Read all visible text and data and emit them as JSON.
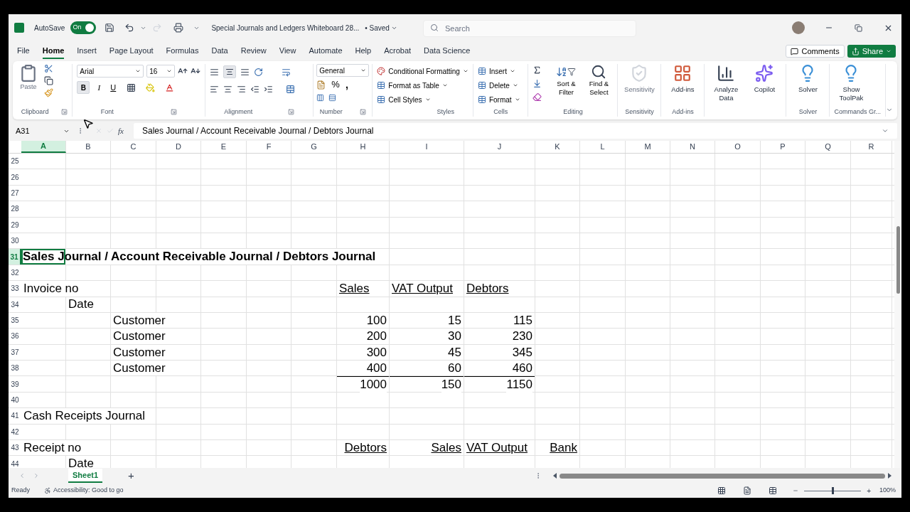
{
  "title_bar": {
    "autosave_label": "AutoSave",
    "autosave_on": true,
    "toggle_text": "On",
    "document_title": "Special Journals and Ledgers Whiteboard 28...",
    "save_status": "• Saved",
    "search_placeholder": "Search"
  },
  "menu_tabs": [
    {
      "label": "File",
      "selected": false
    },
    {
      "label": "Home",
      "selected": true
    },
    {
      "label": "Insert",
      "selected": false
    },
    {
      "label": "Page Layout",
      "selected": false
    },
    {
      "label": "Formulas",
      "selected": false
    },
    {
      "label": "Data",
      "selected": false
    },
    {
      "label": "Review",
      "selected": false
    },
    {
      "label": "View",
      "selected": false
    },
    {
      "label": "Automate",
      "selected": false
    },
    {
      "label": "Help",
      "selected": false
    },
    {
      "label": "Acrobat",
      "selected": false
    },
    {
      "label": "Data Science",
      "selected": false
    }
  ],
  "comments_button": "Comments",
  "share_button": "Share",
  "ribbon": {
    "clipboard": {
      "paste": "Paste",
      "label": "Clipboard"
    },
    "font": {
      "font_name": "Arial",
      "font_size": "16",
      "bold": "B",
      "bold_on": true,
      "italic": "I",
      "underline": "U",
      "label": "Font"
    },
    "alignment": {
      "middle_align_on": true,
      "label": "Alignment"
    },
    "number": {
      "format": "General",
      "percent": "%",
      "comma": ",",
      "label": "Number"
    },
    "styles": {
      "items": [
        "Conditional Formatting",
        "Format as Table",
        "Cell Styles"
      ],
      "label": "Styles"
    },
    "cells": {
      "items": [
        "Insert",
        "Delete",
        "Format"
      ],
      "label": "Cells"
    },
    "editing": {
      "sort": "Sort & Filter",
      "find": "Find & Select",
      "label": "Editing"
    },
    "big_groups": [
      {
        "buttons": [
          {
            "kind": "sensitivity",
            "text": "Sensitivity",
            "disabled": true
          }
        ],
        "label": "Sensitivity"
      },
      {
        "buttons": [
          {
            "kind": "addins",
            "text": "Add-ins",
            "disabled": false
          }
        ],
        "label": "Add-ins"
      },
      {
        "buttons": [
          {
            "kind": "analyze",
            "text": "Analyze Data",
            "disabled": false
          },
          {
            "kind": "copilot",
            "text": "Copilot",
            "disabled": false
          }
        ]
      },
      {
        "buttons": [
          {
            "kind": "solver",
            "text": "Solver",
            "disabled": false
          }
        ],
        "label": "Solver"
      },
      {
        "buttons": [
          {
            "kind": "toolpak",
            "text": "Show ToolPak",
            "disabled": false
          }
        ],
        "label": "Commands Gr..."
      }
    ]
  },
  "formula_bar": {
    "name_box": "A31",
    "fx": "fx",
    "formula": "Sales Journal / Account Receivable Journal / Debtors Journal"
  },
  "columns": [
    {
      "label": "A",
      "selected": true
    },
    {
      "label": "B",
      "selected": false
    },
    {
      "label": "C",
      "selected": false
    },
    {
      "label": "D",
      "selected": false
    },
    {
      "label": "E",
      "selected": false
    },
    {
      "label": "F",
      "selected": false
    },
    {
      "label": "G",
      "selected": false
    },
    {
      "label": "H",
      "selected": false
    },
    {
      "label": "I",
      "selected": false
    },
    {
      "label": "J",
      "selected": false
    },
    {
      "label": "K",
      "selected": false
    },
    {
      "label": "L",
      "selected": false
    },
    {
      "label": "M",
      "selected": false
    },
    {
      "label": "N",
      "selected": false
    },
    {
      "label": "O",
      "selected": false
    },
    {
      "label": "P",
      "selected": false
    },
    {
      "label": "Q",
      "selected": false
    },
    {
      "label": "R",
      "selected": false
    }
  ],
  "rows": [
    {
      "number": "25",
      "selected": false,
      "cells": {}
    },
    {
      "number": "26",
      "selected": false,
      "cells": {}
    },
    {
      "number": "27",
      "selected": false,
      "cells": {}
    },
    {
      "number": "28",
      "selected": false,
      "cells": {}
    },
    {
      "number": "29",
      "selected": false,
      "cells": {}
    },
    {
      "number": "30",
      "selected": false,
      "cells": {}
    },
    {
      "number": "31",
      "selected": true,
      "cells": {
        "A": {
          "text": "Sales Journal / Account Receivable Journal / Debtors Journal",
          "kind": "title"
        }
      }
    },
    {
      "number": "32",
      "selected": false,
      "cells": {}
    },
    {
      "number": "33",
      "selected": false,
      "cells": {
        "A": {
          "text": "Invoice no",
          "kind": "text"
        },
        "H": {
          "text": "Sales",
          "kind": "heading",
          "right_aligned": false
        },
        "I": {
          "text": "VAT Output",
          "kind": "heading",
          "right_aligned": false
        },
        "J": {
          "text": "Debtors",
          "kind": "heading",
          "right_aligned": false
        }
      }
    },
    {
      "number": "34",
      "selected": false,
      "cells": {
        "B": {
          "text": "Date",
          "kind": "text"
        }
      }
    },
    {
      "number": "35",
      "selected": false,
      "cells": {
        "C": {
          "text": "Customer",
          "kind": "text"
        },
        "H": {
          "text": "100",
          "kind": "number"
        },
        "I": {
          "text": "15",
          "kind": "number"
        },
        "J": {
          "text": "115",
          "kind": "number"
        }
      }
    },
    {
      "number": "36",
      "selected": false,
      "cells": {
        "C": {
          "text": "Customer",
          "kind": "text"
        },
        "H": {
          "text": "200",
          "kind": "number"
        },
        "I": {
          "text": "30",
          "kind": "number"
        },
        "J": {
          "text": "230",
          "kind": "number"
        }
      }
    },
    {
      "number": "37",
      "selected": false,
      "cells": {
        "C": {
          "text": "Customer",
          "kind": "text"
        },
        "H": {
          "text": "300",
          "kind": "number"
        },
        "I": {
          "text": "45",
          "kind": "number"
        },
        "J": {
          "text": "345",
          "kind": "number"
        }
      }
    },
    {
      "number": "38",
      "selected": false,
      "cells": {
        "C": {
          "text": "Customer",
          "kind": "text"
        },
        "H": {
          "text": "400",
          "kind": "number"
        },
        "I": {
          "text": "60",
          "kind": "number"
        },
        "J": {
          "text": "460",
          "kind": "number"
        }
      }
    },
    {
      "number": "39",
      "selected": false,
      "cells": {
        "H": {
          "text": "1000",
          "kind": "total"
        },
        "I": {
          "text": "150",
          "kind": "total"
        },
        "J": {
          "text": "1150",
          "kind": "total"
        }
      }
    },
    {
      "number": "40",
      "selected": false,
      "cells": {}
    },
    {
      "number": "41",
      "selected": false,
      "cells": {
        "A": {
          "text": "Cash Receipts Journal",
          "kind": "text"
        }
      }
    },
    {
      "number": "42",
      "selected": false,
      "cells": {}
    },
    {
      "number": "43",
      "selected": false,
      "cells": {
        "A": {
          "text": "Receipt no",
          "kind": "text"
        },
        "H": {
          "text": "Debtors",
          "kind": "heading",
          "right_aligned": true
        },
        "I": {
          "text": "Sales",
          "kind": "heading",
          "right_aligned": true
        },
        "J": {
          "text": "VAT Output",
          "kind": "heading",
          "right_aligned": false
        },
        "K": {
          "text": "Bank",
          "kind": "heading",
          "right_aligned": true
        }
      }
    },
    {
      "number": "44",
      "selected": false,
      "cells": {
        "B": {
          "text": "Date",
          "kind": "text"
        }
      }
    }
  ],
  "sheet_tabs": [
    {
      "label": "Sheet1",
      "selected": true
    }
  ],
  "add_sheet": "+",
  "status_bar": {
    "ready": "Ready",
    "accessibility": "Accessibility: Good to go",
    "zoom_slider": {
      "level": 0.5
    },
    "zoom_in": "+",
    "zoom": "100%"
  }
}
